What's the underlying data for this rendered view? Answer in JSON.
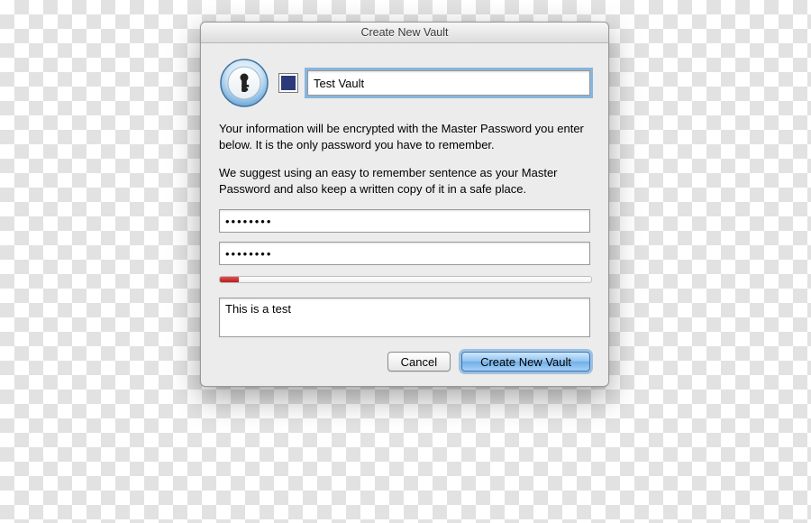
{
  "dialog": {
    "title": "Create New Vault",
    "vault_color": "#2b3a7a",
    "vault_name": "Test Vault",
    "description1": "Your information will be encrypted with the Master Password you enter below. It is the only password you have to remember.",
    "description2": "We suggest using an easy to remember sentence as your Master Password and also keep a written copy of it in a safe place.",
    "password_value": "••••••••",
    "confirm_value": "••••••••",
    "strength_percent": 5,
    "hint_value": "This is a test",
    "cancel_label": "Cancel",
    "create_label": "Create New Vault"
  }
}
